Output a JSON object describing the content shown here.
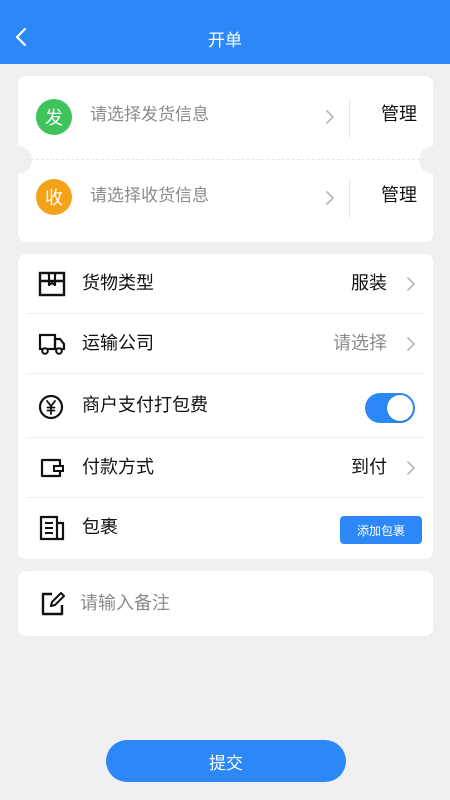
{
  "header": {
    "title": "开单",
    "back_icon": "chevron-left-icon"
  },
  "address": {
    "sender": {
      "badge": "发",
      "placeholder": "请选择发货信息",
      "manage_label": "管理",
      "badge_color": "#3fc45c"
    },
    "receiver": {
      "badge": "收",
      "placeholder": "请选择收货信息",
      "manage_label": "管理",
      "badge_color": "#f5a21b"
    }
  },
  "goods": {
    "cargo_type": {
      "label": "货物类型",
      "value": "服装",
      "icon": "package-icon"
    },
    "carrier": {
      "label": "运输公司",
      "value": "请选择",
      "icon": "truck-icon"
    },
    "merchant_pack_fee": {
      "label": "商户支付打包费",
      "toggle_on": true,
      "icon": "yen-icon"
    },
    "payment": {
      "label": "付款方式",
      "value": "到付",
      "icon": "wallet-icon"
    },
    "package": {
      "label": "包裹",
      "button_label": "添加包裹",
      "icon": "document-icon"
    }
  },
  "note": {
    "placeholder": "请输入备注",
    "icon": "edit-icon"
  },
  "submit_label": "提交",
  "colors": {
    "accent": "#2b88f6",
    "background": "#f0f0f3"
  }
}
